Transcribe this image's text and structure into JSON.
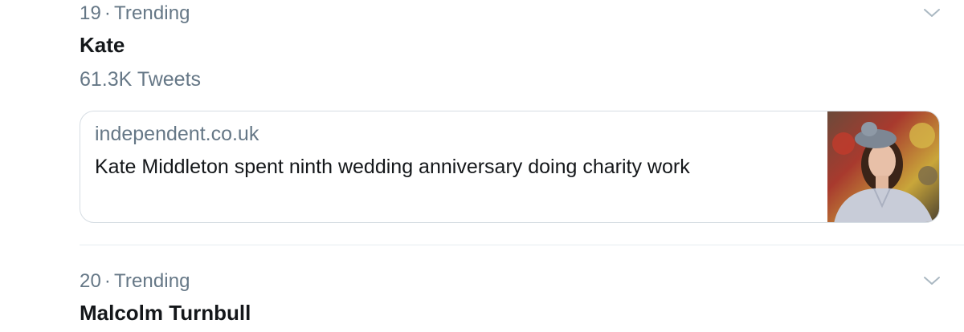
{
  "trends": [
    {
      "rank": "19",
      "category": "Trending",
      "topic": "Kate",
      "tweet_count": "61.3K Tweets",
      "card": {
        "domain": "independent.co.uk",
        "headline": "Kate Middleton spent ninth wedding anniversary doing charity work"
      }
    },
    {
      "rank": "20",
      "category": "Trending",
      "topic": "Malcolm Turnbull"
    }
  ],
  "icons": {
    "more_options": "chevron-down-icon"
  },
  "colors": {
    "primary_text": "#14171a",
    "secondary_text": "#657786",
    "border": "#d6dde3",
    "divider": "#e6ecf0",
    "background": "#ffffff"
  }
}
